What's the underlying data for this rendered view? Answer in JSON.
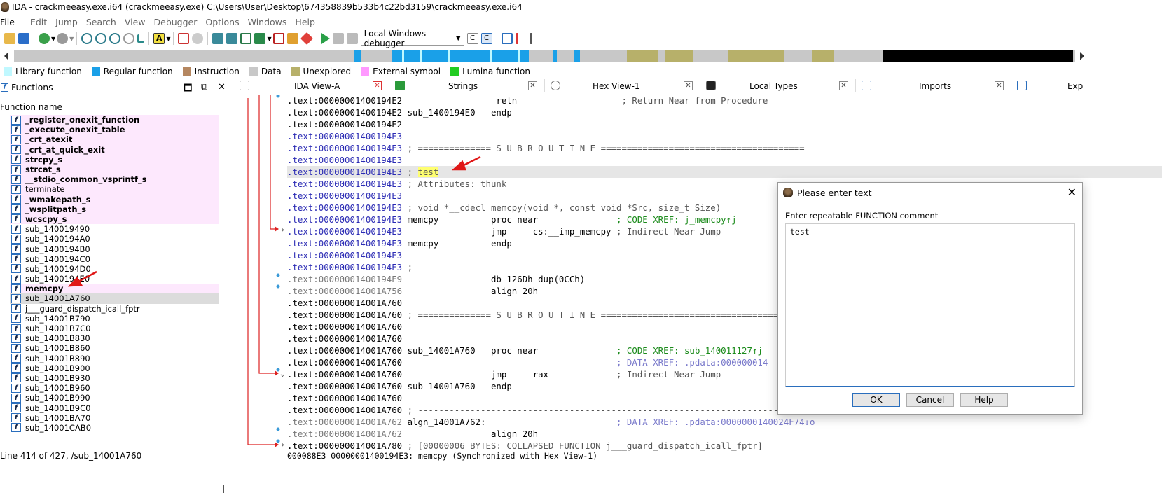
{
  "window": {
    "title": "IDA - crackmeeasy.exe.i64 (crackmeeasy.exe) C:\\Users\\User\\Desktop\\674358839b533b4c22bd3159\\crackmeeasy.exe.i64"
  },
  "menu": [
    "File",
    "Edit",
    "Jump",
    "Search",
    "View",
    "Debugger",
    "Options",
    "Windows",
    "Help"
  ],
  "toolbar": {
    "debugger_select": "Local Windows debugger"
  },
  "legend": [
    {
      "label": "Library function",
      "color": "#c0f8ff"
    },
    {
      "label": "Regular function",
      "color": "#1aa0e8"
    },
    {
      "label": "Instruction",
      "color": "#b58760"
    },
    {
      "label": "Data",
      "color": "#c8c8c8"
    },
    {
      "label": "Unexplored",
      "color": "#b7b06a"
    },
    {
      "label": "External symbol",
      "color": "#ff99ff"
    },
    {
      "label": "Lumina function",
      "color": "#22cc22"
    }
  ],
  "functions_panel": {
    "title": "Functions",
    "column": "Function name",
    "items": [
      {
        "name": "_register_onexit_function",
        "lib": true
      },
      {
        "name": "_execute_onexit_table",
        "lib": true
      },
      {
        "name": "_crt_atexit",
        "lib": true
      },
      {
        "name": "_crt_at_quick_exit",
        "lib": true
      },
      {
        "name": "strcpy_s",
        "lib": true
      },
      {
        "name": "strcat_s",
        "lib": true
      },
      {
        "name": "__stdio_common_vsprintf_s",
        "lib": true
      },
      {
        "name": "terminate",
        "lib": true,
        "normal": true
      },
      {
        "name": "_wmakepath_s",
        "lib": true
      },
      {
        "name": "_wsplitpath_s",
        "lib": true
      },
      {
        "name": "wcscpy_s",
        "lib": true
      },
      {
        "name": "sub_140019490"
      },
      {
        "name": "sub_1400194A0"
      },
      {
        "name": "sub_1400194B0"
      },
      {
        "name": "sub_1400194C0"
      },
      {
        "name": "sub_1400194D0"
      },
      {
        "name": "sub_1400194E0"
      },
      {
        "name": "memcpy",
        "lib": true
      },
      {
        "name": "sub_14001A760",
        "sel": true
      },
      {
        "name": "j___guard_dispatch_icall_fptr"
      },
      {
        "name": "sub_14001B790"
      },
      {
        "name": "sub_14001B7C0"
      },
      {
        "name": "sub_14001B830"
      },
      {
        "name": "sub_14001B860"
      },
      {
        "name": "sub_14001B890"
      },
      {
        "name": "sub_14001B900"
      },
      {
        "name": "sub_14001B930"
      },
      {
        "name": "sub_14001B960"
      },
      {
        "name": "sub_14001B990"
      },
      {
        "name": "sub_14001B9C0"
      },
      {
        "name": "sub_14001BA70"
      },
      {
        "name": "sub_14001CAB0"
      }
    ],
    "status": "Line 414 of 427, /sub_14001A760"
  },
  "tabs": [
    "IDA View-A",
    "Strings",
    "Hex View-1",
    "Local Types",
    "Imports",
    "Exp"
  ],
  "code_lines": [
    {
      "addr": ".text:00000001400194E2",
      "c": "b",
      "rest": "                  retn                    ; Return Near from Procedure"
    },
    {
      "addr": ".text:00000001400194E2",
      "c": "b",
      "rest": " sub_1400194E0   endp"
    },
    {
      "addr": ".text:00000001400194E2",
      "c": "b",
      "rest": ""
    },
    {
      "addr": ".text:00000001400194E3",
      "c": "bb",
      "rest": ""
    },
    {
      "addr": ".text:00000001400194E3",
      "c": "bb",
      "rest": " ; ============== S U B R O U T I N E ======================================="
    },
    {
      "addr": ".text:00000001400194E3",
      "c": "bb",
      "rest": ""
    },
    {
      "addr": ".text:00000001400194E3",
      "c": "bb",
      "rest": " ; test",
      "hl": true
    },
    {
      "addr": ".text:00000001400194E3",
      "c": "bb",
      "rest": " ; Attributes: thunk"
    },
    {
      "addr": ".text:00000001400194E3",
      "c": "bb",
      "rest": ""
    },
    {
      "addr": ".text:00000001400194E3",
      "c": "bb",
      "rest": " ; void *__cdecl memcpy(void *, const void *Src, size_t Size)"
    },
    {
      "addr": ".text:00000001400194E3",
      "c": "bb",
      "rest": " memcpy          proc near               ; CODE XREF: j_memcpy↑j"
    },
    {
      "addr": ".text:00000001400194E3",
      "c": "bb",
      "rest": "                 jmp     cs:__imp_memcpy ; Indirect Near Jump"
    },
    {
      "addr": ".text:00000001400194E3",
      "c": "bb",
      "rest": " memcpy          endp"
    },
    {
      "addr": ".text:00000001400194E3",
      "c": "bb",
      "rest": ""
    },
    {
      "addr": ".text:00000001400194E3",
      "c": "bb",
      "rest": " ; ---------------------------------------------------------------------------"
    },
    {
      "addr": ".text:00000001400194E9",
      "c": "g",
      "rest": "                 db 126Dh dup(0CCh)"
    },
    {
      "addr": ".text:000000014001A756",
      "c": "g",
      "rest": "                 align 20h"
    },
    {
      "addr": ".text:000000014001A760",
      "c": "k",
      "rest": ""
    },
    {
      "addr": ".text:000000014001A760",
      "c": "k",
      "rest": " ; ============== S U B R O U T I N E ======================================="
    },
    {
      "addr": ".text:000000014001A760",
      "c": "k",
      "rest": ""
    },
    {
      "addr": ".text:000000014001A760",
      "c": "k",
      "rest": ""
    },
    {
      "addr": ".text:000000014001A760",
      "c": "k",
      "rest": " sub_14001A760   proc near               ; CODE XREF: sub_140011127↑j"
    },
    {
      "addr": ".text:000000014001A760",
      "c": "k",
      "rest": "                                         ; DATA XREF: .pdata:000000014"
    },
    {
      "addr": ".text:000000014001A760",
      "c": "k",
      "rest": "                 jmp     rax             ; Indirect Near Jump"
    },
    {
      "addr": ".text:000000014001A760",
      "c": "k",
      "rest": " sub_14001A760   endp"
    },
    {
      "addr": ".text:000000014001A760",
      "c": "k",
      "rest": ""
    },
    {
      "addr": ".text:000000014001A760",
      "c": "k",
      "rest": " ; ---------------------------------------------------------------------------"
    },
    {
      "addr": ".text:000000014001A762",
      "c": "g",
      "rest": " algn_14001A762:                         ; DATA XREF: .pdata:0000000140024F74↓o"
    },
    {
      "addr": ".text:000000014001A762",
      "c": "g",
      "rest": "                 align 20h"
    },
    {
      "addr": ".text:000000014001A780",
      "c": "k",
      "rest": " ; [00000006 BYTES: COLLAPSED FUNCTION j___guard_dispatch_icall_fptr]"
    }
  ],
  "code_status": "000088E3 00000001400194E3: memcpy (Synchronized with Hex View-1)",
  "dialog": {
    "title": "Please enter text",
    "prompt": "Enter repeatable FUNCTION comment",
    "value": "test",
    "ok": "OK",
    "cancel": "Cancel",
    "help": "Help"
  }
}
